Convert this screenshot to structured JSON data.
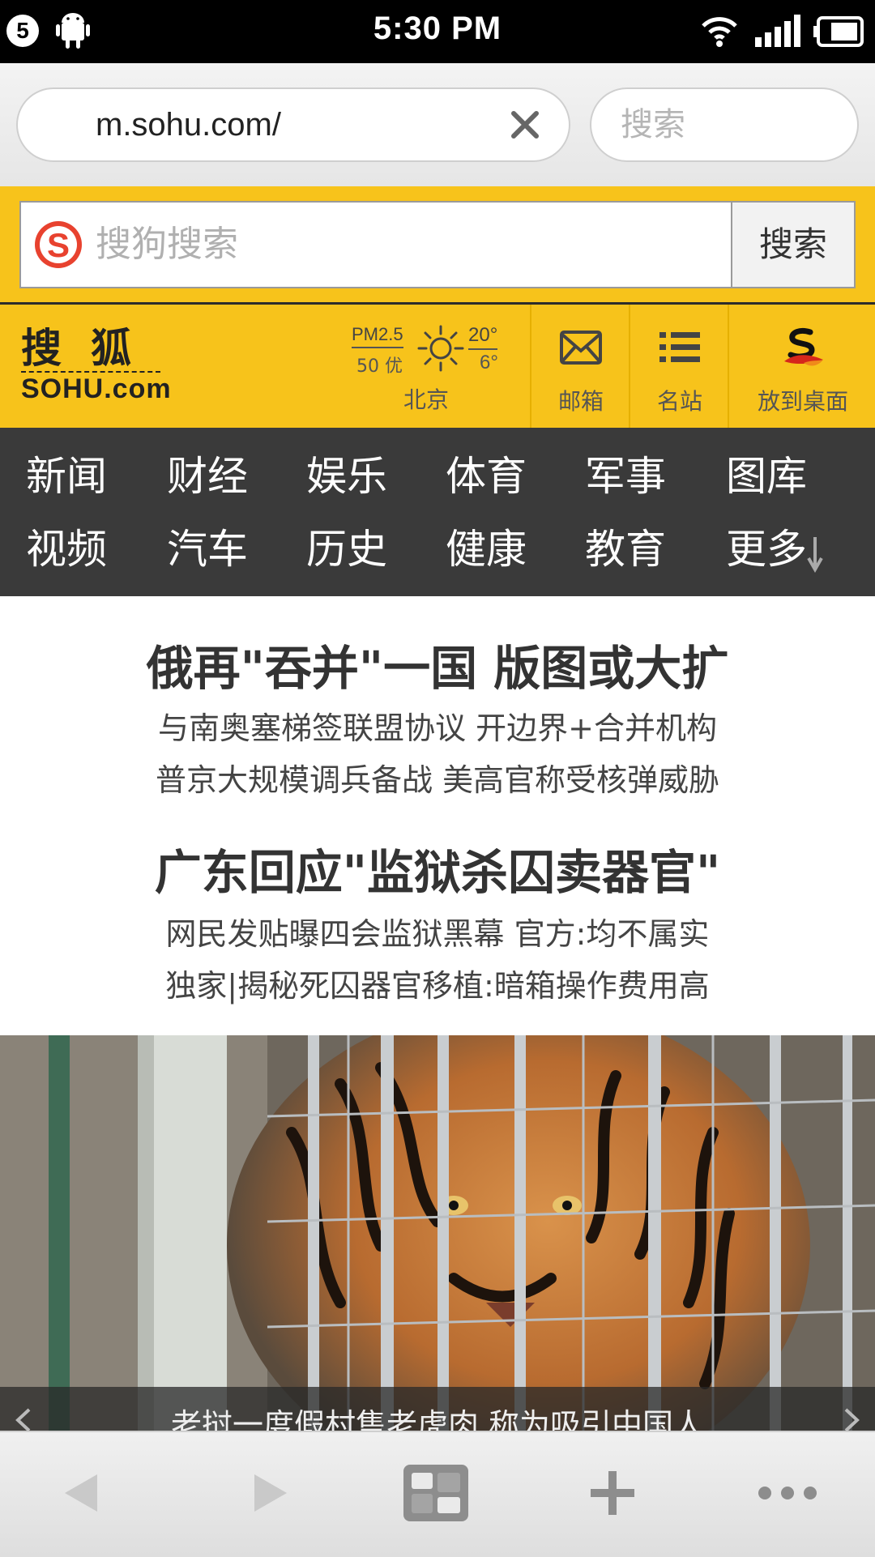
{
  "status_bar": {
    "notification_count": "5",
    "time": "5:30 PM",
    "icons": [
      "android-icon",
      "wifi-icon",
      "signal-icon",
      "battery-icon"
    ]
  },
  "browser": {
    "url": "m.sohu.com/",
    "search_placeholder": "搜索"
  },
  "sogou": {
    "placeholder": "搜狗搜索",
    "button_label": "搜索"
  },
  "header": {
    "logo_top": "搜狐",
    "logo_bottom": "SOHU.com",
    "weather": {
      "pm_label": "PM2.5",
      "pm_value": "50 优",
      "temp_high": "20°",
      "temp_low": "6°",
      "city": "北京",
      "icon": "sun-icon"
    },
    "shortcuts": [
      {
        "label": "邮箱",
        "icon": "mail-icon"
      },
      {
        "label": "名站",
        "icon": "list-icon"
      },
      {
        "label": "放到桌面",
        "icon": "sohu-s-icon"
      }
    ]
  },
  "nav": {
    "row1": [
      "新闻",
      "财经",
      "娱乐",
      "体育",
      "军事",
      "图库"
    ],
    "row2": [
      "视频",
      "汽车",
      "历史",
      "健康",
      "教育",
      "更多"
    ]
  },
  "headlines": [
    {
      "title": "俄再\"吞并\"一国 版图或大扩",
      "subs": [
        "与南奥塞梯签联盟协议 开边界+合并机构",
        "普京大规模调兵备战 美高官称受核弹威胁"
      ]
    },
    {
      "title": "广东回应\"监狱杀囚卖器官\"",
      "subs": [
        "网民发贴曝四会监狱黑幕 官方:均不属实",
        "独家|揭秘死囚器官移植:暗箱操作费用高"
      ]
    }
  ],
  "photo": {
    "caption": "老挝一度假村售老虎肉 称为吸引中国人"
  },
  "colors": {
    "accent_yellow": "#f7c31b",
    "nav_dark": "#3a3a3a",
    "sogou_red": "#e8422f"
  },
  "toolbar": {
    "icons": [
      "back-icon",
      "forward-icon",
      "tabs-icon",
      "add-icon",
      "more-icon"
    ]
  }
}
